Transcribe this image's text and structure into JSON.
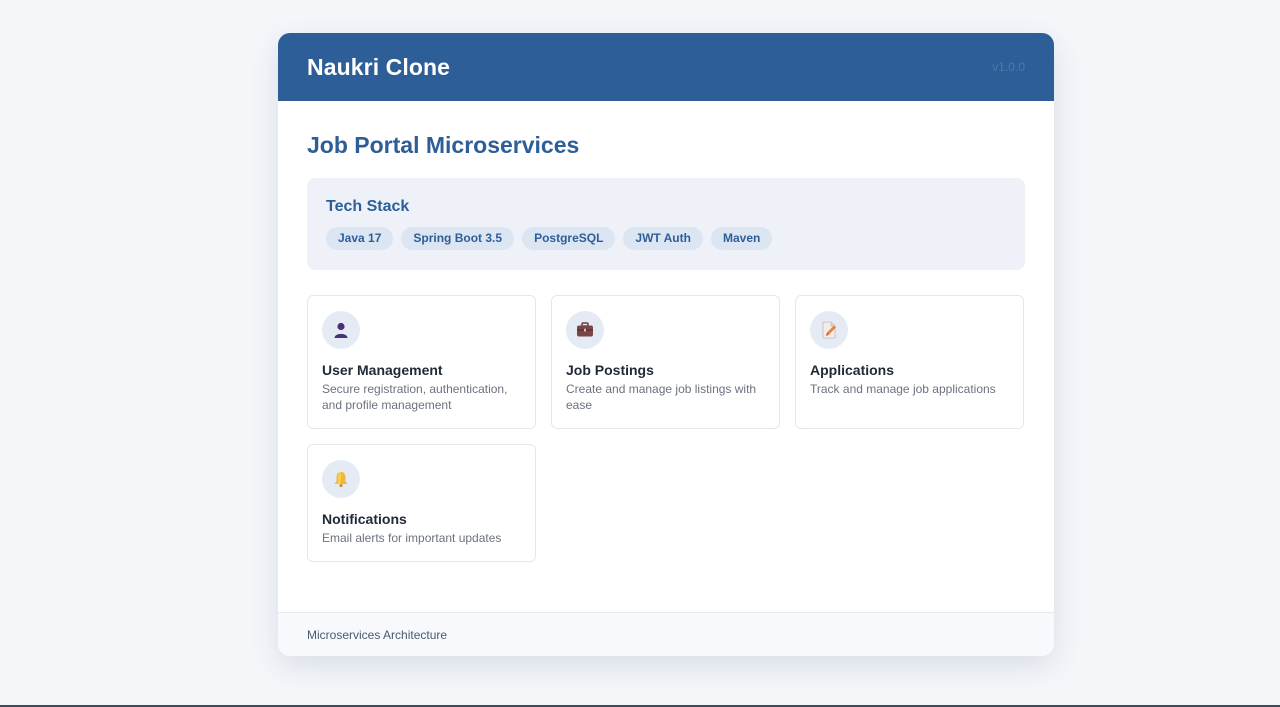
{
  "header": {
    "brand": "Naukri Clone",
    "version": "v1.0.0"
  },
  "main": {
    "title": "Job Portal Microservices",
    "tech_stack": {
      "title": "Tech Stack",
      "items": [
        "Java 17",
        "Spring Boot 3.5",
        "PostgreSQL",
        "JWT Auth",
        "Maven"
      ]
    },
    "features": [
      {
        "icon": "user-icon",
        "title": "User Management",
        "description": "Secure registration, authentication, and profile management"
      },
      {
        "icon": "briefcase-icon",
        "title": "Job Postings",
        "description": "Create and manage job listings with ease"
      },
      {
        "icon": "document-edit-icon",
        "title": "Applications",
        "description": "Track and manage job applications"
      },
      {
        "icon": "bell-icon",
        "title": "Notifications",
        "description": "Email alerts for important updates"
      }
    ]
  },
  "footer": {
    "text": "Microservices Architecture"
  },
  "colors": {
    "brand_blue": "#2e5e98",
    "page_background": "#f4f6fa",
    "tech_box_background": "#eef2f8"
  }
}
